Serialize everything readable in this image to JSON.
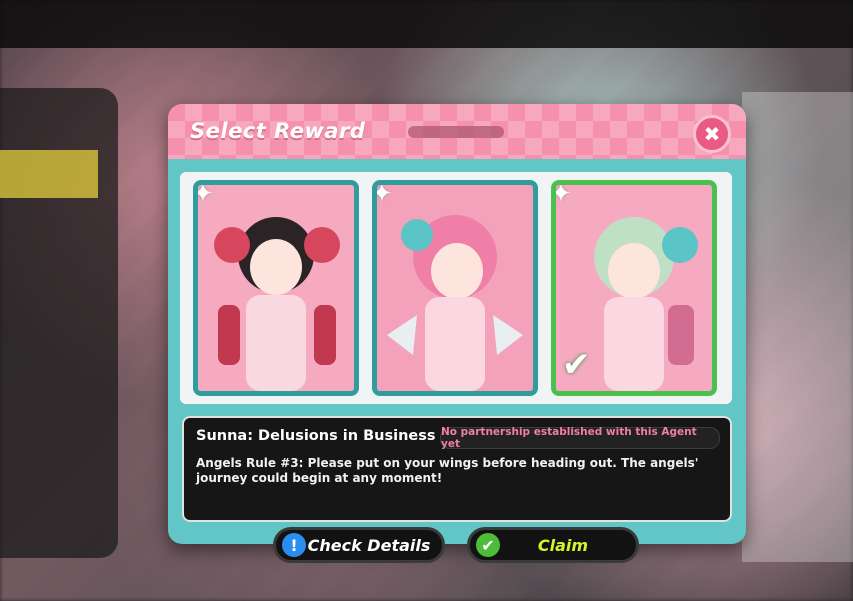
{
  "modal": {
    "title": "Select Reward",
    "close_symbol": "✖"
  },
  "cards": [
    {
      "name": "Agent reward option 1",
      "selected": false
    },
    {
      "name": "Agent reward option 2",
      "selected": false
    },
    {
      "name": "Agent reward option 3",
      "selected": true
    }
  ],
  "description": {
    "title": "Sunna: Delusions in Business",
    "partnership_status": "No partnership established with this Agent yet",
    "text": "Angels Rule #3: Please put on your wings before heading out. The angels' journey could begin at any moment!"
  },
  "buttons": {
    "check_details": "Check Details",
    "check_details_icon": "!",
    "claim": "Claim",
    "claim_icon": "✔"
  },
  "colors": {
    "accent_pink": "#f590ad",
    "frame_teal": "#62c5c6",
    "selected_green": "#4cc04f",
    "claim_text": "#d7f22a"
  }
}
